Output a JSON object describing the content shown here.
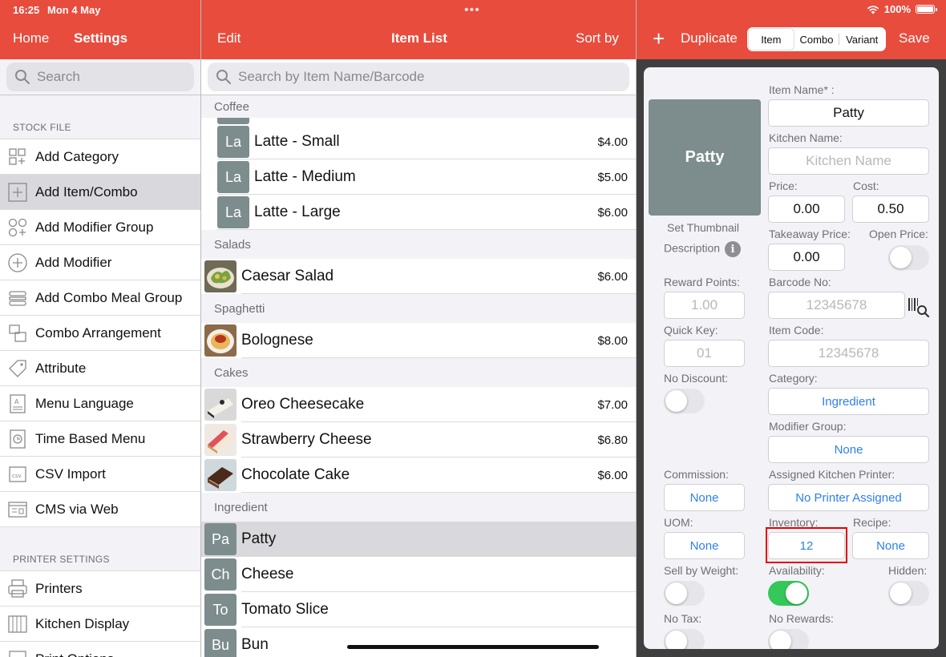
{
  "status": {
    "time": "16:25",
    "date": "Mon 4 May",
    "battery": "100%"
  },
  "nav": {
    "home": "Home",
    "settings": "Settings",
    "edit": "Edit",
    "title": "Item List",
    "sort": "Sort by",
    "add": "+",
    "duplicate": "Duplicate",
    "segments": [
      "Item",
      "Combo",
      "Variant"
    ],
    "active_segment": "Item",
    "save": "Save"
  },
  "sidebar": {
    "search_placeholder": "Search",
    "sections": [
      {
        "title": "STOCK FILE",
        "items": [
          {
            "label": "Add Category",
            "icon": "category-grid-icon"
          },
          {
            "label": "Add Item/Combo",
            "icon": "plus-square-icon",
            "selected": true
          },
          {
            "label": "Add Modifier Group",
            "icon": "modifier-group-icon"
          },
          {
            "label": "Add Modifier",
            "icon": "plus-circle-icon"
          },
          {
            "label": "Add Combo Meal Group",
            "icon": "combo-meal-icon"
          },
          {
            "label": "Combo Arrangement",
            "icon": "arrangement-icon"
          },
          {
            "label": "Attribute",
            "icon": "tag-icon"
          },
          {
            "label": "Menu Language",
            "icon": "language-icon"
          },
          {
            "label": "Time Based Menu",
            "icon": "clock-menu-icon"
          },
          {
            "label": "CSV Import",
            "icon": "csv-icon"
          },
          {
            "label": "CMS via Web",
            "icon": "web-icon"
          }
        ]
      },
      {
        "title": "PRINTER SETTINGS",
        "items": [
          {
            "label": "Printers",
            "icon": "printer-icon"
          },
          {
            "label": "Kitchen Display",
            "icon": "kitchen-display-icon"
          },
          {
            "label": "Print Options",
            "icon": "print-options-icon"
          }
        ]
      }
    ]
  },
  "list": {
    "search_placeholder": "Search by Item Name/Barcode",
    "groups": [
      {
        "name": "Coffee",
        "items": [
          {
            "name": "Latte - Small",
            "price": "$4.00",
            "badge": "La"
          },
          {
            "name": "Latte - Medium",
            "price": "$5.00",
            "badge": "La"
          },
          {
            "name": "Latte - Large",
            "price": "$6.00",
            "badge": "La"
          }
        ]
      },
      {
        "name": "Salads",
        "items": [
          {
            "name": "Caesar Salad",
            "price": "$6.00",
            "thumb": "salad"
          }
        ]
      },
      {
        "name": "Spaghetti",
        "items": [
          {
            "name": "Bolognese",
            "price": "$8.00",
            "thumb": "pasta"
          }
        ]
      },
      {
        "name": "Cakes",
        "items": [
          {
            "name": "Oreo Cheesecake",
            "price": "$7.00",
            "thumb": "oreo"
          },
          {
            "name": "Strawberry Cheese",
            "price": "$6.80",
            "thumb": "strawberry"
          },
          {
            "name": "Chocolate Cake",
            "price": "$6.00",
            "thumb": "chocolate"
          }
        ]
      },
      {
        "name": "Ingredient",
        "items": [
          {
            "name": "Patty",
            "price": "",
            "badge": "Pa",
            "selected": true
          },
          {
            "name": "Cheese",
            "price": "",
            "badge": "Ch"
          },
          {
            "name": "Tomato Slice",
            "price": "",
            "badge": "To"
          },
          {
            "name": "Bun",
            "price": "",
            "badge": "Bu"
          }
        ]
      }
    ]
  },
  "detail": {
    "thumbnail_text": "Patty",
    "set_thumbnail": "Set Thumbnail",
    "description": "Description",
    "item_name_label": "Item Name* :",
    "item_name": "Patty",
    "kitchen_name_label": "Kitchen Name:",
    "kitchen_name_placeholder": "Kitchen Name",
    "price_label": "Price:",
    "price": "0.00",
    "cost_label": "Cost:",
    "cost": "0.50",
    "takeaway_label": "Takeaway Price:",
    "takeaway": "0.00",
    "open_price_label": "Open Price:",
    "reward_label": "Reward Points:",
    "reward_placeholder": "1.00",
    "barcode_label": "Barcode No:",
    "barcode_placeholder": "12345678",
    "quick_key_label": "Quick Key:",
    "quick_key_placeholder": "01",
    "item_code_label": "Item Code:",
    "item_code_placeholder": "12345678",
    "no_discount_label": "No Discount:",
    "category_label": "Category:",
    "category": "Ingredient",
    "modifier_group_label": "Modifier Group:",
    "modifier_group": "None",
    "commission_label": "Commission:",
    "commission": "None",
    "kitchen_printer_label": "Assigned Kitchen Printer:",
    "kitchen_printer": "No Printer Assigned",
    "uom_label": "UOM:",
    "uom": "None",
    "inventory_label": "Inventory:",
    "inventory": "12",
    "recipe_label": "Recipe:",
    "recipe": "None",
    "sell_by_weight_label": "Sell by Weight:",
    "availability_label": "Availability:",
    "hidden_label": "Hidden:",
    "no_tax_label": "No Tax:",
    "no_rewards_label": "No Rewards:",
    "toggles": {
      "open_price": false,
      "no_discount": false,
      "sell_by_weight": false,
      "availability": true,
      "hidden": false,
      "no_tax": false,
      "no_rewards": false
    }
  },
  "colors": {
    "accent": "#e84c3d",
    "link": "#2f80ed",
    "toggle_on": "#34c759",
    "badge": "#7d8c8c"
  }
}
